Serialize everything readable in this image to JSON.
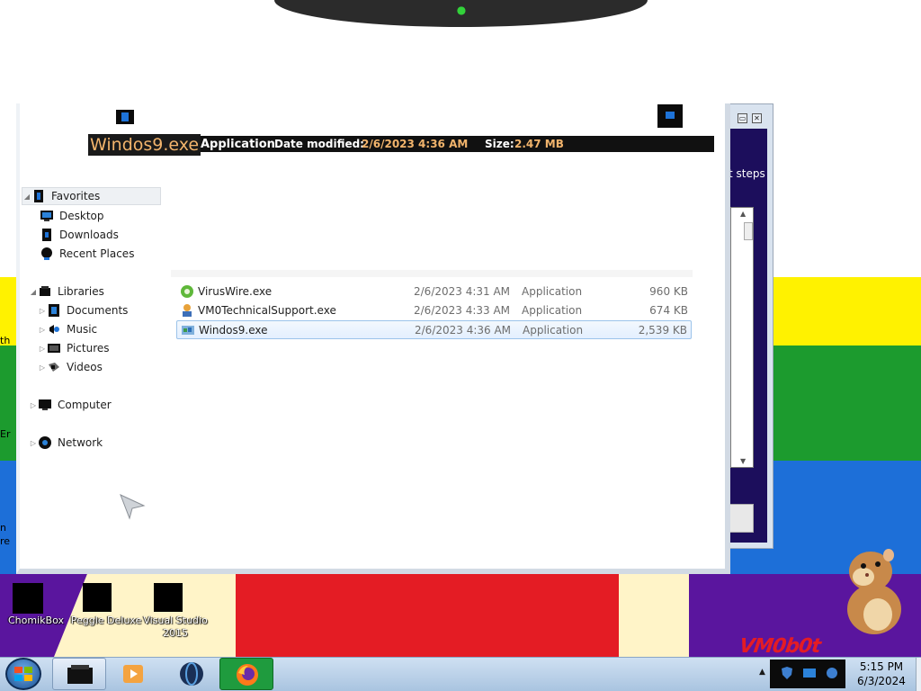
{
  "colors": {
    "accent_orange": "#f2b46c",
    "selection_border": "#9cc3ea",
    "taskbar": "#bcd3ea"
  },
  "details_bar": {
    "file_name": "Windos9.exe",
    "file_type": "Application",
    "date_modified_label": "Date modified:",
    "date_modified_value": "2/6/2023 4:36 AM",
    "size_label": "Size:",
    "size_value": "2.47 MB"
  },
  "back_window": {
    "text": "t steps"
  },
  "nav": {
    "favorites": {
      "label": "Favorites",
      "items": [
        "Desktop",
        "Downloads",
        "Recent Places"
      ]
    },
    "libraries": {
      "label": "Libraries",
      "items": [
        "Documents",
        "Music",
        "Pictures",
        "Videos"
      ]
    },
    "computer": "Computer",
    "network": "Network"
  },
  "files": [
    {
      "name": "VirusWire.exe",
      "date": "2/6/2023 4:31 AM",
      "type": "Application",
      "size": "960 KB",
      "icon": "green-gear-icon"
    },
    {
      "name": "VM0TechnicalSupport.exe",
      "date": "2/6/2023 4:33 AM",
      "type": "Application",
      "size": "674 KB",
      "icon": "support-person-icon"
    },
    {
      "name": "Windos9.exe",
      "date": "2/6/2023 4:36 AM",
      "type": "Application",
      "size": "2,539 KB",
      "icon": "windows-icon",
      "selected": true
    }
  ],
  "desktop_icons": [
    "ChomikBox",
    "Peggle Deluxe",
    "Visual Studio 2015"
  ],
  "brand_text": "VM0b0t",
  "edge_texts": [
    "th",
    "Er",
    "n",
    "re"
  ],
  "taskbar": {
    "items": [
      "explorer-icon",
      "media-player-icon",
      "globe-icon",
      "firefox-icon"
    ],
    "time": "5:15 PM",
    "date": "6/3/2024"
  }
}
